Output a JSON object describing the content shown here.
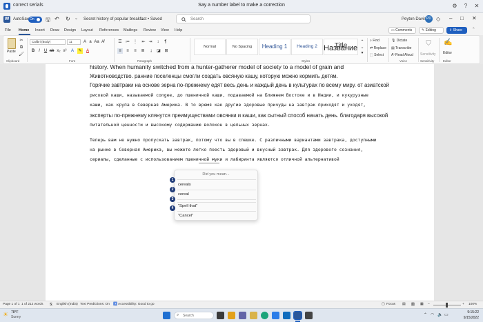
{
  "voice_access": {
    "command": "correct serials",
    "message": "Say a number label to make a correction",
    "settings_icon": "gear-icon",
    "help_icon": "help-icon",
    "close_icon": "close-icon"
  },
  "title_bar": {
    "autosave_label": "AutoSave",
    "autosave_state": "On",
    "doc_title": "Secret history of popular breakfast • Saved",
    "search_placeholder": "Search",
    "user_name": "Peyton Davis",
    "user_initials": "PD"
  },
  "tabs": [
    "File",
    "Home",
    "Insert",
    "Draw",
    "Design",
    "Layout",
    "References",
    "Mailings",
    "Review",
    "View",
    "Help"
  ],
  "active_tab": "Home",
  "ribbon_actions": {
    "comments": "Comments",
    "editing": "Editing",
    "share": "Share"
  },
  "ribbon": {
    "clipboard_label": "Clipboard",
    "paste_label": "Paste",
    "font_label": "Font",
    "font_name": "Calibri (Body)",
    "font_size": "11",
    "paragraph_label": "Paragraph",
    "styles_label": "Styles",
    "styles": [
      "Normal",
      "No Spacing",
      "Heading 1",
      "Heading 2",
      "Title"
    ],
    "editing_items": [
      "Find",
      "Replace",
      "Select"
    ],
    "voice_items": [
      "Dictate",
      "Transcribe",
      "Read Aloud"
    ],
    "voice_label": "Voice",
    "sensitivity_label": "Sensitivity",
    "editor_label": "Editor"
  },
  "document": {
    "float_title": "Название",
    "lines": [
      "history. When humanity switched from a hunter-gatherer model of society to a model of grain and",
      "Животноводство. ранние поселенцы смогли создать овсяную кашу, которую можно кормить детям.",
      "Горячие завтраки на основе зерна по-прежнему едят весь день и каждый день в культурах по всему миру. от азиатской",
      "рисовой каши, называемой congee, до пшеничной каши, подаваемой на Ближнем Востоке и в Индии, и кукурузные",
      "каши, как крупа в Северная Америка. В то время как другие здоровые причуды на завтрак приходят и уходят,",
      "эксперты по-прежнему клянутся преимуществами овсянки и каши, как сытный способ начать день. благодаря высокой",
      "питательной ценности и высокому содержанию волокон в цельных зернах.",
      "Теперь вам не нужно пропускать завтрак, потому что вы в спешке. С различными вариантами завтрака, доступными",
      "на рынке в Северная Америка, вы можете легко поесть здоровый и вкусный завтрак. Для здорового сознания,",
      "сериалы, сделанные с использованием пшеничной муки и лабиринта являются отличной альтернативой"
    ]
  },
  "popup": {
    "title": "Did you mean...",
    "items": [
      {
        "number": "1",
        "text": "cereals"
      },
      {
        "number": "2",
        "text": "cereal"
      },
      {
        "number": "3",
        "text": ""
      },
      {
        "number": "4",
        "text": "\"Spell that\""
      },
      {
        "number": "",
        "text": "\"Cancel\""
      }
    ]
  },
  "status_bar": {
    "page": "Page 1 of 1",
    "words": "1 of 212 words",
    "language": "English (India)",
    "text_predictions": "Text Predictions: On",
    "accessibility": "Accessibility: Good to go",
    "focus": "Focus",
    "zoom": "100%"
  },
  "taskbar": {
    "temperature": "78°F",
    "weather": "Sunny",
    "search_placeholder": "Search",
    "time": "9:15:22",
    "date": "9/15/2022"
  },
  "colors": {
    "accent": "#1f5fbf",
    "word_blue": "#2b579a",
    "badge": "#1e3a78"
  }
}
